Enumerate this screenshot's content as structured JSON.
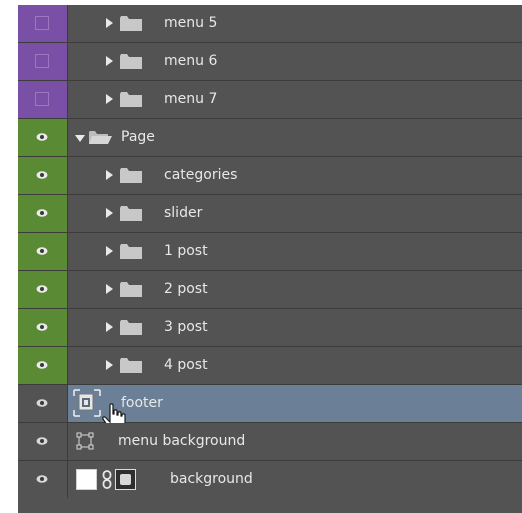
{
  "layers": [
    {
      "label": "menu 5",
      "vis": "purple",
      "kind": "group",
      "expanded": false
    },
    {
      "label": "menu 6",
      "vis": "purple",
      "kind": "group",
      "expanded": false
    },
    {
      "label": "menu 7",
      "vis": "purple",
      "kind": "group",
      "expanded": false
    },
    {
      "label": "Page",
      "vis": "green",
      "kind": "group",
      "expanded": true
    },
    {
      "label": "categories",
      "vis": "green",
      "kind": "group",
      "expanded": false
    },
    {
      "label": "slider",
      "vis": "green",
      "kind": "group",
      "expanded": false
    },
    {
      "label": "1 post",
      "vis": "green",
      "kind": "group",
      "expanded": false
    },
    {
      "label": "2 post",
      "vis": "green",
      "kind": "group",
      "expanded": false
    },
    {
      "label": "3 post",
      "vis": "green",
      "kind": "group",
      "expanded": false
    },
    {
      "label": "4 post",
      "vis": "green",
      "kind": "group",
      "expanded": false
    },
    {
      "label": "footer",
      "vis": "grey",
      "kind": "smart-object",
      "selected": true
    },
    {
      "label": "menu background",
      "vis": "grey",
      "kind": "shape"
    },
    {
      "label": "background",
      "vis": "grey",
      "kind": "masked-fill"
    }
  ],
  "colors": {
    "panel": "#535353",
    "selected": "#6b7f96",
    "purple": "#7a4fa6",
    "green": "#5b8a35"
  }
}
